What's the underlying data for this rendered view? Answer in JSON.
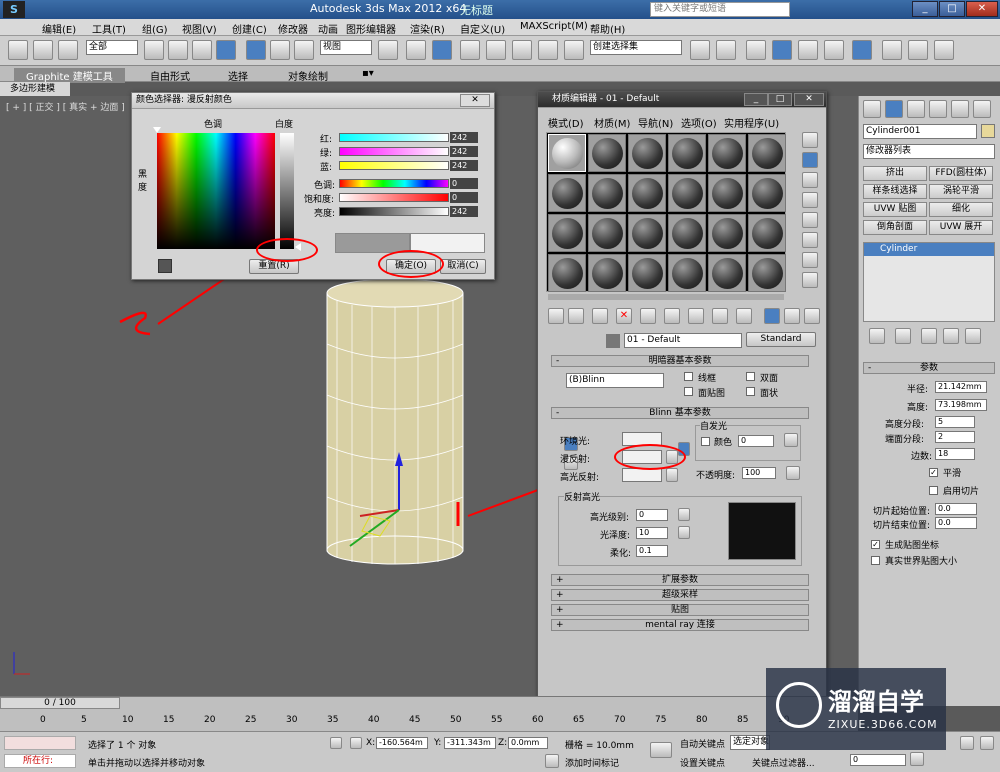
{
  "titlebar": {
    "title": "Autodesk 3ds Max  2012 x64",
    "subtitle": "无标题",
    "search_placeholder": "键入关键字或短语"
  },
  "menubar": [
    "编辑(E)",
    "工具(T)",
    "组(G)",
    "视图(V)",
    "创建(C)",
    "修改器",
    "动画",
    "图形编辑器",
    "渲染(R)",
    "自定义(U)",
    "MAXScript(M)",
    "帮助(H)"
  ],
  "toolbar": {
    "selection_filter": "全部",
    "ref_coord": "视图",
    "named_selection": "创建选择集"
  },
  "ribbon": {
    "tabs": [
      "Graphite 建模工具",
      "自由形式",
      "选择",
      "对象绘制"
    ],
    "sub": "多边形建模"
  },
  "viewport": {
    "label": "[ + ] [ 正交 ] [ 真实 + 边面 ]"
  },
  "color_picker": {
    "title": "颜色选择器: 漫反射颜色",
    "hue_label": "色调",
    "white_label": "白度",
    "black_label": "黑\n度",
    "rows": [
      {
        "label": "红:",
        "value": "242"
      },
      {
        "label": "绿:",
        "value": "242"
      },
      {
        "label": "蓝:",
        "value": "242"
      },
      {
        "label": "色调:",
        "value": "0"
      },
      {
        "label": "饱和度:",
        "value": "0"
      },
      {
        "label": "亮度:",
        "value": "242"
      }
    ],
    "reset_label": "重置(R)",
    "ok_label": "确定(O)",
    "cancel_label": "取消(C)"
  },
  "material_editor": {
    "title": "材质编辑器 - 01 - Default",
    "menu": [
      "模式(D)",
      "材质(M)",
      "导航(N)",
      "选项(O)",
      "实用程序(U)"
    ],
    "material_name": "01 - Default",
    "material_type": "Standard",
    "shader_rollout": "明暗器基本参数",
    "shader": "(B)Blinn",
    "shader_options": [
      "线框",
      "双面",
      "面贴图",
      "面状"
    ],
    "blinn_rollout": "Blinn 基本参数",
    "self_illum": {
      "title": "自发光",
      "color_label": "颜色",
      "value": "0"
    },
    "ambient_label": "环境光:",
    "diffuse_label": "漫反射:",
    "specular_label": "高光反射:",
    "opacity_label": "不透明度:",
    "opacity_value": "100",
    "spec_group": "反射高光",
    "spec_level_label": "高光级别:",
    "spec_level": "0",
    "gloss_label": "光泽度:",
    "gloss": "10",
    "soften_label": "柔化:",
    "soften": "0.1",
    "rollouts": [
      "扩展参数",
      "超级采样",
      "贴图",
      "mental ray 连接"
    ]
  },
  "command_panel": {
    "object_name": "Cylinder001",
    "modifier_list": "修改器列表",
    "buttons": [
      "挤出",
      "FFD(圆柱体)",
      "样条线选择",
      "涡轮平滑",
      "UVW 贴图",
      "细化",
      "倒角剖面",
      "UVW 展开"
    ],
    "stack_item": "Cylinder",
    "params_title": "参数",
    "params": [
      {
        "label": "半径:",
        "value": "21.142mm"
      },
      {
        "label": "高度:",
        "value": "73.198mm"
      },
      {
        "label": "高度分段:",
        "value": "5"
      },
      {
        "label": "端面分段:",
        "value": "2"
      },
      {
        "label": "边数:",
        "value": "18"
      }
    ],
    "smooth_label": "平滑",
    "slice_label": "启用切片",
    "slice_from_label": "切片起始位置:",
    "slice_from": "0.0",
    "slice_to_label": "切片结束位置:",
    "slice_to": "0.0",
    "gen_map_label": "生成贴图坐标",
    "real_world_label": "真实世界贴图大小"
  },
  "timeline": {
    "frame": "0 / 100",
    "ticks": [
      "0",
      "5",
      "10",
      "15",
      "20",
      "25",
      "30",
      "35",
      "40",
      "45",
      "50",
      "55",
      "60",
      "65",
      "70",
      "75",
      "80",
      "85",
      "90"
    ]
  },
  "status": {
    "mode": "所在行:",
    "selected": "选择了 1 个 对象",
    "hint": "单击并拖动以选择并移动对象",
    "x": "-160.564m",
    "y": "-311.343m",
    "z": "0.0mm",
    "grid": "栅格 = 10.0mm",
    "add_time_tag": "添加时间标记",
    "auto_key": "自动关键点",
    "set_key": "设置关键点",
    "selected_set": "选定对象",
    "key_filter": "关键点过滤器...",
    "frame_value": "0"
  },
  "annotations": {
    "mark1": "1",
    "mark2": "2"
  },
  "watermark": {
    "brand": "溜溜自学",
    "url": "ZIXUE.3D66.COM"
  }
}
